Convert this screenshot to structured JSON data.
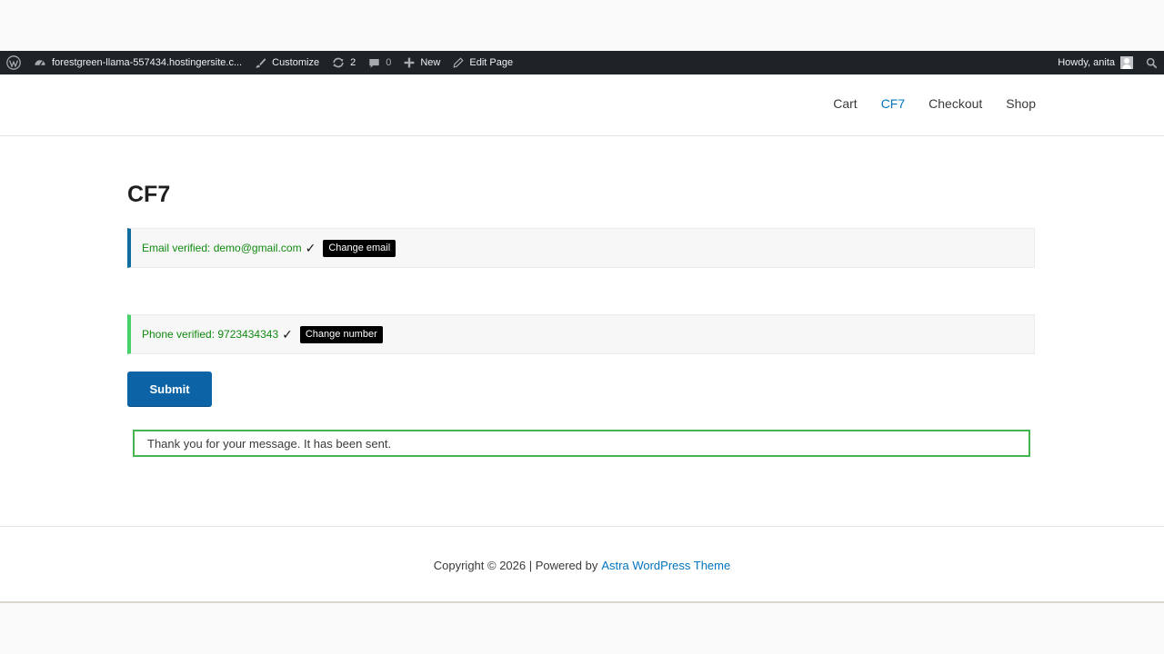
{
  "adminbar": {
    "site_name": "forestgreen-llama-557434.hostingersite.c...",
    "customize": "Customize",
    "updates_count": "2",
    "comments_count": "0",
    "new_label": "New",
    "edit_page": "Edit Page",
    "howdy": "Howdy, anita",
    "background_color": "#1d2327"
  },
  "nav": {
    "items": [
      {
        "label": "Cart"
      },
      {
        "label": "CF7"
      },
      {
        "label": "Checkout"
      },
      {
        "label": "Shop"
      }
    ],
    "current": "CF7",
    "accent_color": "#0274be"
  },
  "page": {
    "title": "CF7",
    "email_status": "Email verified: demo@gmail.com",
    "email_check": "✓",
    "change_email": "Change email",
    "phone_status": "Phone verified: 9723434343",
    "phone_check": "✓",
    "change_number": "Change number",
    "submit_label": "Submit",
    "response_message": "Thank you for your message. It has been sent."
  },
  "footer": {
    "copyright": "Copyright © 2026 | Powered by",
    "theme_link": "Astra WordPress Theme"
  },
  "colors": {
    "success_green": "#118a11",
    "submit_blue": "#0c64a6",
    "response_border": "#46b450"
  }
}
